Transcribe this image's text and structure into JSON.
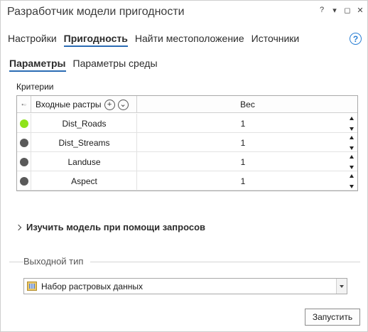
{
  "window": {
    "title": "Разработчик модели пригодности",
    "controls": {
      "help": "?",
      "menu": "▾",
      "restore": "◻",
      "close": "✕"
    }
  },
  "tabs": [
    {
      "label": "Настройки",
      "active": false
    },
    {
      "label": "Пригодность",
      "active": true
    },
    {
      "label": "Найти местоположение",
      "active": false
    },
    {
      "label": "Источники",
      "active": false
    }
  ],
  "help_icon": "?",
  "subtabs": [
    {
      "label": "Параметры",
      "active": true
    },
    {
      "label": "Параметры среды",
      "active": false
    }
  ],
  "criteria": {
    "label": "Критерии",
    "columns": {
      "rasters": "Входные растры",
      "add_btn": "+",
      "menu_btn": "⌄",
      "weight": "Вес"
    },
    "rows": [
      {
        "name": "Dist_Roads",
        "weight": "1",
        "color": "#8fe31a"
      },
      {
        "name": "Dist_Streams",
        "weight": "1",
        "color": "#5a5a5a"
      },
      {
        "name": "Landuse",
        "weight": "1",
        "color": "#5a5a5a"
      },
      {
        "name": "Aspect",
        "weight": "1",
        "color": "#5a5a5a"
      }
    ]
  },
  "explore": {
    "label": "Изучить модель при помощи запросов"
  },
  "output": {
    "label": "Выходной тип",
    "selected": "Набор растровых данных"
  },
  "run_button": "Запустить",
  "colors": {
    "accent": "#2b6cb4",
    "help": "#2a7fd4"
  }
}
